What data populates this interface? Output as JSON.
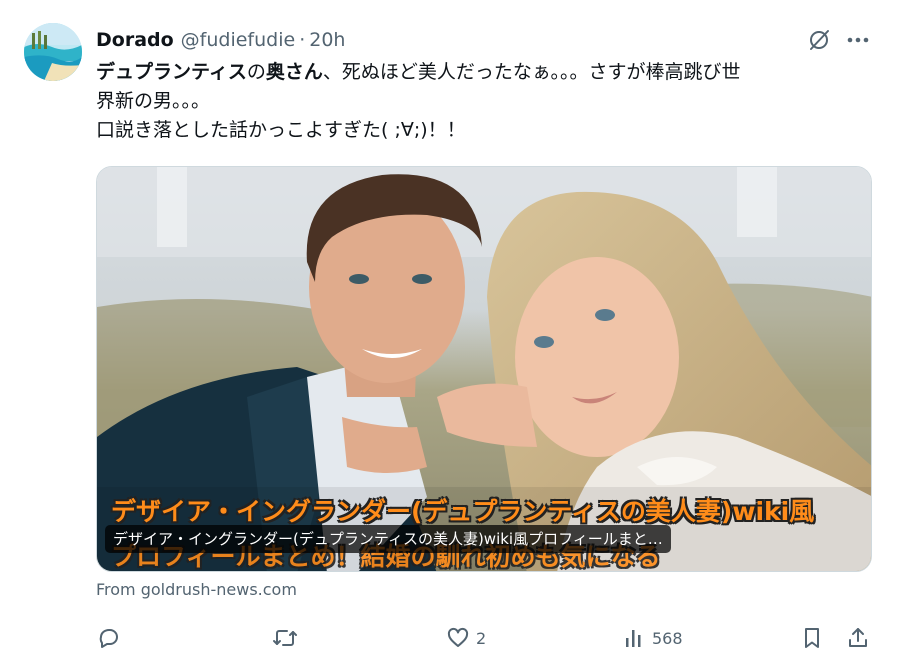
{
  "tweet": {
    "author": {
      "display_name": "Dorado",
      "handle": "@fudiefudie",
      "separator": "·",
      "time": "20h"
    },
    "text": {
      "line1_bold_a": "デュプランティス",
      "line1_mid": "の",
      "line1_bold_b": "奥さん",
      "line1_rest": "、死ぬほど美人だったなぁ。。。さすが棒高跳び世",
      "line2": "界新の男。。。",
      "line3": "口説き落とした話かっこよすぎた( ;∀;)！！"
    },
    "card": {
      "overlay_line1": "デザイア・イングランダー(デュプランティスの美人妻)wiki風",
      "overlay_line2": "プロフィールまとめ！結婚の馴れ初めも気になる",
      "title": "デザイア・イングランダー(デュプランティスの美人妻)wiki風プロフィールまと…",
      "source": "From goldrush-news.com"
    },
    "actions": {
      "reply_icon": "reply-icon",
      "retweet_icon": "retweet-icon",
      "like_icon": "heart-icon",
      "like_count": "2",
      "views_icon": "views-icon",
      "views_count": "568",
      "bookmark_icon": "bookmark-icon",
      "share_icon": "share-icon"
    }
  },
  "colors": {
    "text_primary": "#0f1419",
    "text_secondary": "#536471",
    "overlay_orange": "#ff8c1a"
  }
}
